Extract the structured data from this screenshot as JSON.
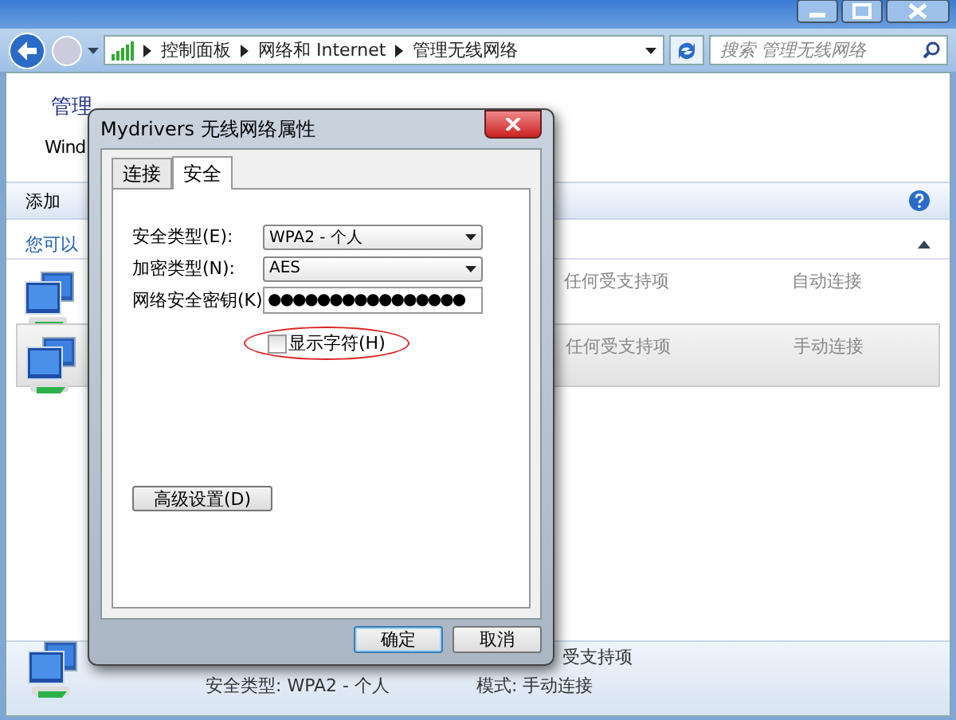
{
  "address_bar": {
    "breadcrumbs": [
      "控制面板",
      "网络和 Internet",
      "管理无线网络"
    ]
  },
  "search": {
    "placeholder": "搜索 管理无线网络"
  },
  "header": {
    "title": "管理",
    "subtitle": "Wind"
  },
  "toolbar": {
    "items": [
      "添加"
    ]
  },
  "list": {
    "heading": "您可以",
    "rows": [
      {
        "security": "任何受支持项",
        "mode": "自动连接",
        "selected": false
      },
      {
        "security": "任何受支持项",
        "mode": "手动连接",
        "selected": true
      }
    ]
  },
  "details": {
    "line_1": "受支持项",
    "security": "安全类型: WPA2 - 个人",
    "mode": "模式: 手动连接"
  },
  "dialog": {
    "title": "Mydrivers 无线网络属性",
    "tabs": [
      {
        "label": "连接",
        "selected": false
      },
      {
        "label": "安全",
        "selected": true
      }
    ],
    "fields": [
      {
        "label": "安全类型(E):",
        "kind": "dropdown",
        "value": "WPA2 - 个人"
      },
      {
        "label": "加密类型(N):",
        "kind": "dropdown",
        "value": "AES"
      },
      {
        "label": "网络安全密钥(K)",
        "kind": "password",
        "value": "●●●●●●●●●●●●●●●●"
      }
    ],
    "show_characters": {
      "label": "显示字符(H)",
      "checked": false,
      "highlighted": true
    },
    "advanced_button": "高级设置(D)",
    "buttons": [
      {
        "label": "确定",
        "default": true
      },
      {
        "label": "取消",
        "default": false
      }
    ]
  }
}
